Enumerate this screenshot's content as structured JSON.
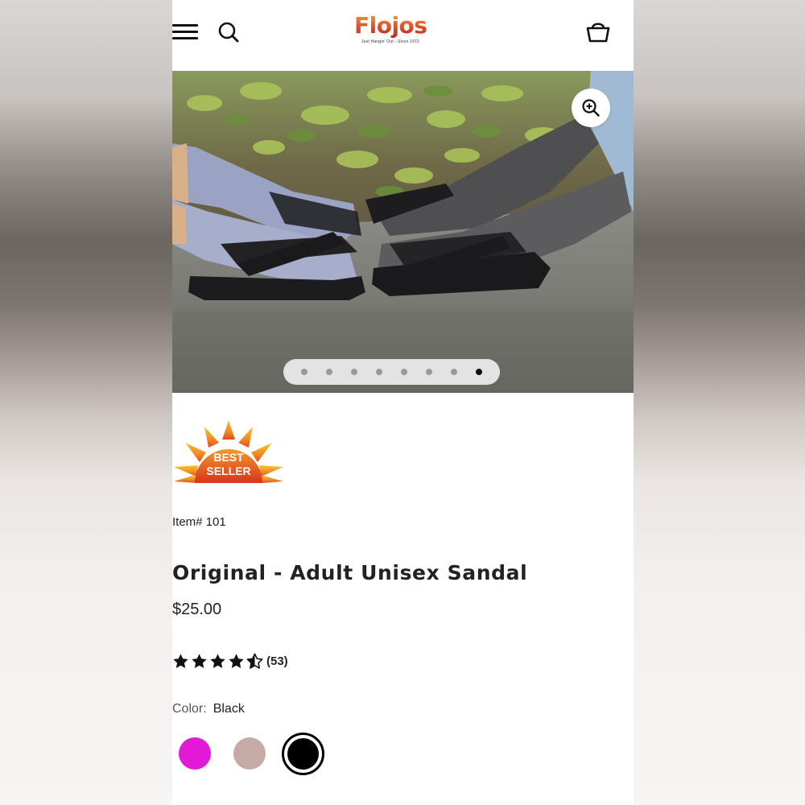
{
  "header": {
    "menu_icon": "hamburger-menu-icon",
    "search_icon": "search-icon",
    "logo_text": "Flojos",
    "logo_tagline": "Just Hangin' Out - Since 1972",
    "cart_icon": "shopping-basket-icon"
  },
  "gallery": {
    "zoom_icon": "zoom-in-icon",
    "slide_count": 8,
    "active_slide": 8
  },
  "badge": {
    "line1": "BEST",
    "line2": "SELLER"
  },
  "product": {
    "item_number": "Item# 101",
    "title": "Original - Adult Unisex Sandal",
    "price": "$25.00",
    "rating": 4.5,
    "review_count": "(53)",
    "color_label": "Color:",
    "color_value": "Black",
    "swatches": [
      {
        "name": "Magenta",
        "hex": "#e21ad8",
        "selected": false
      },
      {
        "name": "Taupe",
        "hex": "#c6aaa6",
        "selected": false
      },
      {
        "name": "Black",
        "hex": "#000000",
        "selected": true
      }
    ]
  },
  "colors": {
    "logo_orange": "#e4542a",
    "text": "#222222"
  }
}
